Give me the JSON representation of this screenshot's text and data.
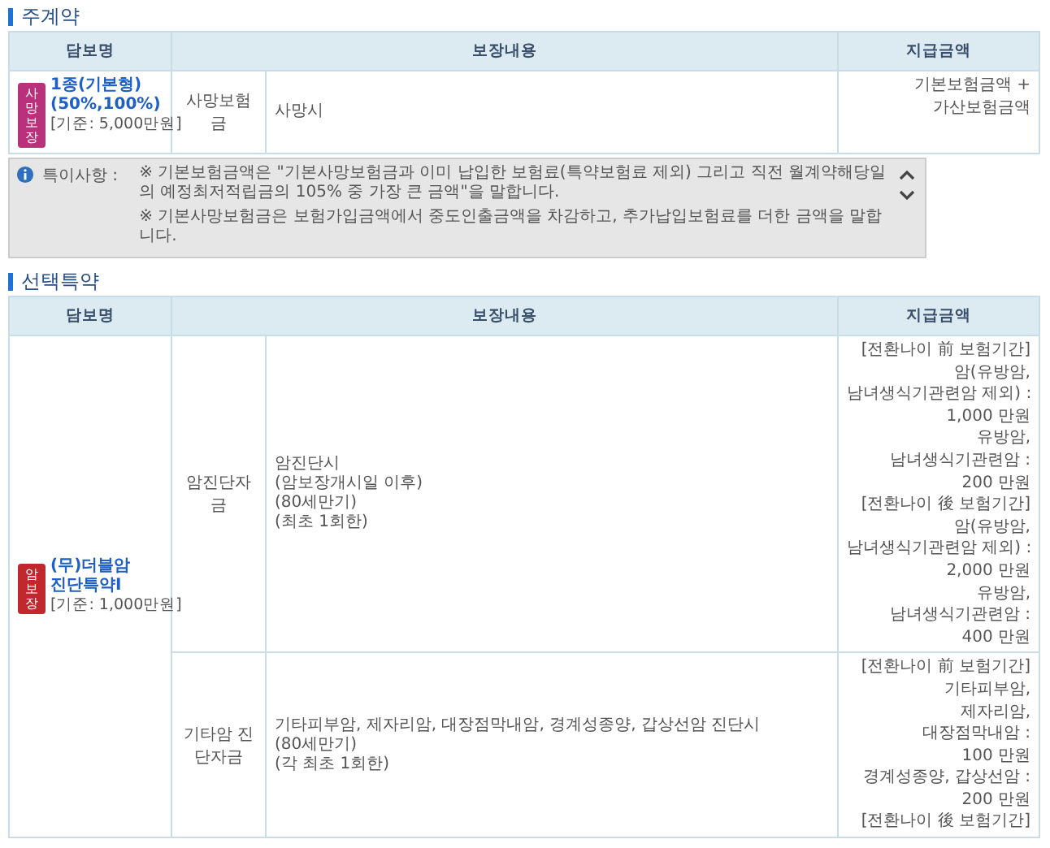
{
  "sections": [
    {
      "title": "주계약",
      "columns": [
        "담보명",
        "보장내용",
        "지급금액"
      ],
      "rows": [
        {
          "badge": {
            "text": "사망보장",
            "color": "#b8317a"
          },
          "name_lines": [
            "1종(기본형)",
            "(50%,100%)"
          ],
          "basis": "[기준: 5,000만원]",
          "coverages": [
            {
              "benefit": "사망보험금",
              "condition_lines": [
                "사망시"
              ],
              "payout_lines": [
                "기본보험금액 +",
                "가산보험금액"
              ]
            }
          ]
        }
      ],
      "notice": {
        "label": "특이사항 :",
        "paragraphs": [
          "※ 기본보험금액은 \"기본사망보험금과 이미 납입한 보험료(특약보험료 제외) 그리고 직전 월계약해당일의 예정최저적립금의 105% 중 가장 큰 금액\"을 말합니다.",
          "※ 기본사망보험금은 보험가입금액에서 중도인출금액을 차감하고, 추가납입보험료를 더한 금액을 말합니다."
        ]
      }
    },
    {
      "title": "선택특약",
      "columns": [
        "담보명",
        "보장내용",
        "지급금액"
      ],
      "rows": [
        {
          "badge": {
            "text": "암보장",
            "color": "#c0282e"
          },
          "name_lines": [
            "(무)더블암",
            "진단특약Ⅰ"
          ],
          "basis": "[기준: 1,000만원]",
          "coverages": [
            {
              "benefit": "암진단자금",
              "condition_lines": [
                "암진단시",
                "(암보장개시일 이후)",
                "(80세만기)",
                "(최초 1회한)"
              ],
              "payout_lines": [
                "[전환나이 前 보험기간]",
                "암(유방암,",
                "남녀생식기관련암 제외) :",
                "1,000 만원",
                "유방암,",
                "남녀생식기관련암 :",
                "200 만원",
                "[전환나이 後 보험기간]",
                "암(유방암,",
                "남녀생식기관련암 제외) :",
                "2,000 만원",
                "유방암,",
                "남녀생식기관련암 :",
                "400 만원"
              ]
            },
            {
              "benefit": "기타암 진단자금",
              "condition_lines": [
                "기타피부암, 제자리암, 대장점막내암, 경계성종양, 갑상선암 진단시",
                "(80세만기)",
                "(각 최초 1회한)"
              ],
              "payout_lines": [
                "[전환나이 前 보험기간]",
                "기타피부암,",
                "제자리암,",
                "대장점막내암 :",
                "100 만원",
                "경계성종양, 갑상선암 :",
                "200 만원",
                "[전환나이 後 보험기간]"
              ]
            }
          ]
        }
      ]
    }
  ]
}
